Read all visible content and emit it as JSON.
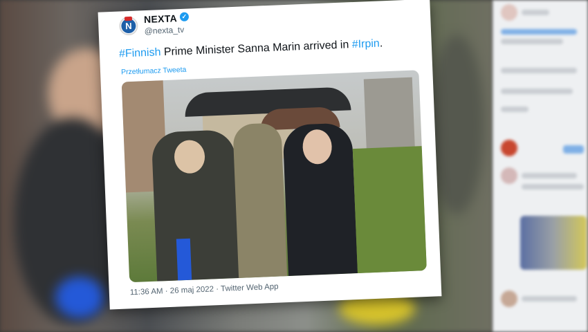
{
  "tweet": {
    "author_name": "NEXTA",
    "author_handle": "@nexta_tv",
    "avatar_letter": "N",
    "text_parts": [
      "#Finnish",
      " Prime Minister Sanna Marin arrived in ",
      "#Irpin",
      "."
    ],
    "translate_link": "Przetłumacz Tweeta",
    "time": "11:36 AM",
    "separator": " · ",
    "date": "26 maj 2022",
    "separator2": " · ",
    "client": "Twitter Web App"
  },
  "colors": {
    "hashtag": "#1d9bf0",
    "verified": "#1d9bf0",
    "avatar_blue": "#1d5fa8",
    "avatar_red": "#d62b2b"
  },
  "icons": [
    "verified-badge-icon"
  ]
}
